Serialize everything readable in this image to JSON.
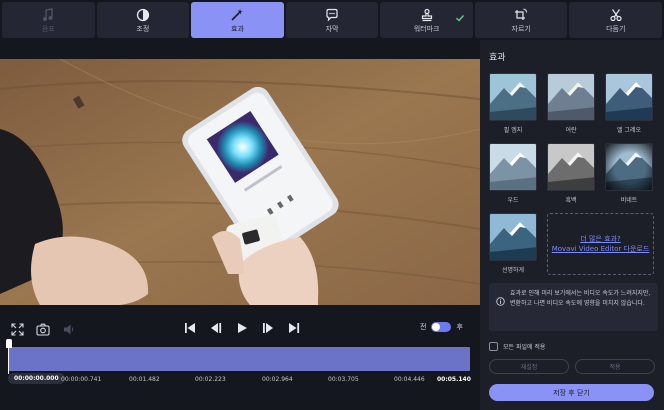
{
  "toolbar": {
    "tabs": [
      {
        "label": "음표",
        "icon": "music-note-icon"
      },
      {
        "label": "조정",
        "icon": "contrast-icon"
      },
      {
        "label": "효과",
        "icon": "magic-wand-icon"
      },
      {
        "label": "자막",
        "icon": "speech-bubble-icon"
      },
      {
        "label": "워터마크",
        "icon": "stamp-icon"
      },
      {
        "label": "자르기",
        "icon": "crop-rotate-icon"
      },
      {
        "label": "다듬기",
        "icon": "scissors-icon"
      }
    ],
    "active_tab": "효과",
    "watermark_check_icon": "checkmark-icon"
  },
  "player": {
    "compare_before": "전",
    "compare_after": "후",
    "current_time": "00:00:00.000",
    "ruler_ticks": [
      "00:00:00.741",
      "00:01.482",
      "00:02.223",
      "00:02.964",
      "00:03.705",
      "00:04.446",
      "00:05.140"
    ],
    "icons": [
      "fullscreen-icon",
      "camera-icon",
      "volume-icon",
      "skip-start-icon",
      "frame-back-icon",
      "play-icon",
      "frame-forward-icon",
      "skip-end-icon"
    ]
  },
  "effects_panel": {
    "title": "효과",
    "effects": [
      {
        "label": "필 엠지"
      },
      {
        "label": "어란"
      },
      {
        "label": "엘 그레오"
      },
      {
        "label": "우드"
      },
      {
        "label": "흑백"
      },
      {
        "label": "비네트"
      },
      {
        "label": "선명하게"
      }
    ],
    "more_line1": "더 많은 효과?",
    "more_line2": "Movavi Video Editor 다운로드",
    "info_text": "효과로 인해 미리 보기에서는 비디오 속도가 느려지지만, 변환하고 나면 비디오 속도에 영향을 미치지 않습니다.",
    "apply_all_label": "모든 파일에 적용",
    "reset_label": "재설정",
    "apply_label": "적용",
    "save_close_label": "저장 후 닫기"
  },
  "colors": {
    "accent": "#8a93f5",
    "background": "#15171f",
    "panel": "#1c1e28",
    "timeline": "#6b73c9",
    "link": "#7d8cff"
  }
}
